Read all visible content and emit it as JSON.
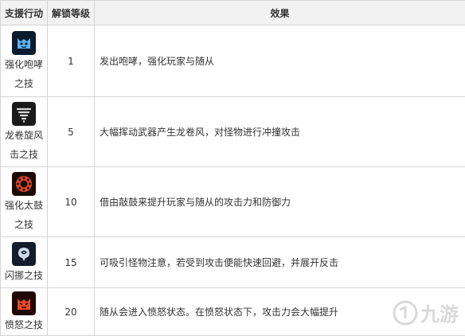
{
  "header": {
    "col1": "支援行动",
    "col2": "解锁等级",
    "col3": "效果"
  },
  "rows": [
    {
      "name_line1": "强化咆哮",
      "name_line2": "之技",
      "icon": "cat-roar-icon",
      "level": "1",
      "effect": "发出咆哮，强化玩家与随从"
    },
    {
      "name_line1": "龙卷旋风",
      "name_line2": "击之技",
      "icon": "tornado-icon",
      "level": "5",
      "effect": "大幅挥动武器产生龙卷风，对怪物进行冲撞攻击"
    },
    {
      "name_line1": "强化太鼓",
      "name_line2": "之技",
      "icon": "drum-icon",
      "level": "10",
      "effect": "借由敲鼓来提升玩家与随从的攻击力和防御力"
    },
    {
      "name_line1": "闪挪之技",
      "name_line2": "",
      "icon": "dodge-icon",
      "level": "15",
      "effect": "可吸引怪物注意，若受到攻击便能快速回避，并展开反击"
    },
    {
      "name_line1": "愤怒之技",
      "name_line2": "",
      "icon": "angry-cat-icon",
      "level": "20",
      "effect": "随从会进入愤怒状态。在愤怒状态下，攻击力会大幅提升"
    }
  ],
  "watermark": "九游"
}
